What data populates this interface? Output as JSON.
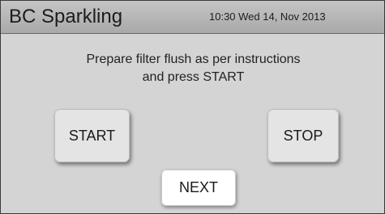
{
  "header": {
    "title": "BC Sparkling",
    "datetime": "10:30 Wed 14, Nov 2013"
  },
  "main": {
    "instruction_line1": "Prepare filter flush as per instructions",
    "instruction_line2": "and press START"
  },
  "buttons": {
    "start_label": "START",
    "stop_label": "STOP",
    "next_label": "NEXT"
  }
}
